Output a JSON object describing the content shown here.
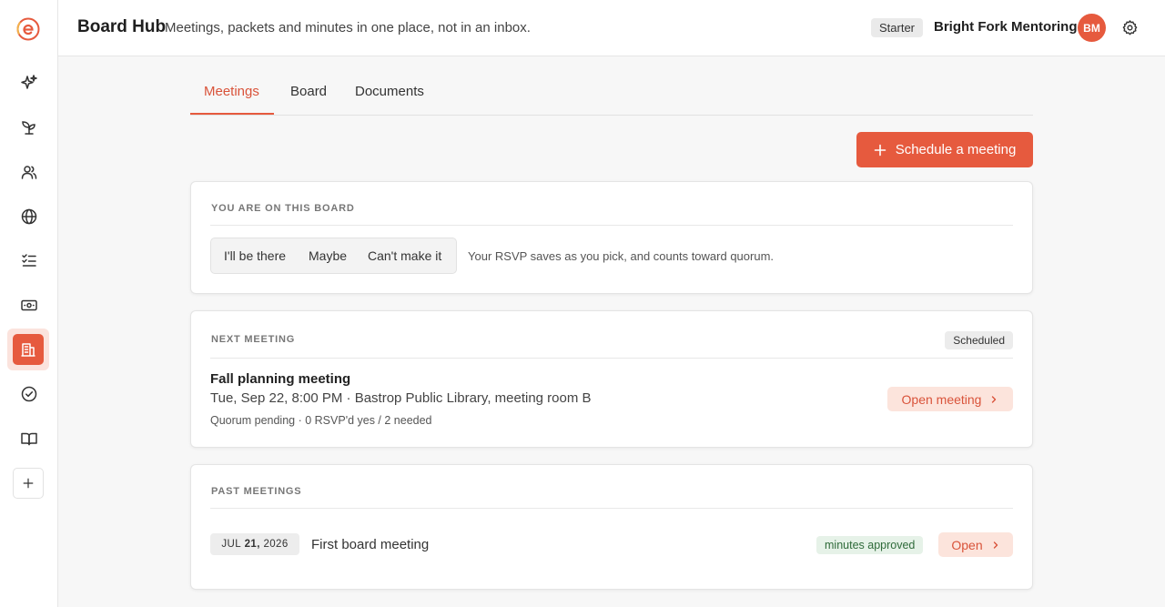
{
  "header": {
    "title": "Board Hub",
    "subtitle": "Meetings, packets and minutes in one place, not in an inbox.",
    "plan": "Starter",
    "org_name": "Bright Fork Mentoring",
    "avatar_initials": "BM"
  },
  "sidebar": {
    "items": [
      {
        "icon": "sparkle-icon"
      },
      {
        "icon": "sprout-icon"
      },
      {
        "icon": "users-icon"
      },
      {
        "icon": "globe-icon"
      },
      {
        "icon": "checklist-icon"
      },
      {
        "icon": "money-icon"
      },
      {
        "icon": "building-icon",
        "active": true
      },
      {
        "icon": "check-circle-icon"
      },
      {
        "icon": "book-icon"
      },
      {
        "icon": "plus-icon"
      }
    ]
  },
  "tabs": [
    {
      "label": "Meetings",
      "active": true
    },
    {
      "label": "Board"
    },
    {
      "label": "Documents"
    }
  ],
  "actions": {
    "schedule_label": "Schedule a meeting"
  },
  "rsvp_card": {
    "label": "YOU ARE ON THIS BOARD",
    "options": [
      "I'll be there",
      "Maybe",
      "Can't make it"
    ],
    "note": "Your RSVP saves as you pick, and counts toward quorum."
  },
  "next_meeting": {
    "label": "NEXT MEETING",
    "status": "Scheduled",
    "title": "Fall planning meeting",
    "when": "Tue, Sep 22, 8:00 PM · Bastrop Public Library, meeting room B",
    "quorum": "Quorum pending · 0 RSVP'd yes / 2 needed",
    "open_label": "Open meeting"
  },
  "past_meetings": {
    "label": "PAST MEETINGS",
    "items": [
      {
        "date_month": "JUL",
        "date_day": "21,",
        "date_year": "2026",
        "title": "First board meeting",
        "badge": "minutes approved",
        "open_label": "Open"
      }
    ]
  },
  "colors": {
    "accent": "#e65a3e",
    "accent_soft": "#fce4dc",
    "success_bg": "#e6f2e8",
    "success_text": "#2f6b3a"
  }
}
